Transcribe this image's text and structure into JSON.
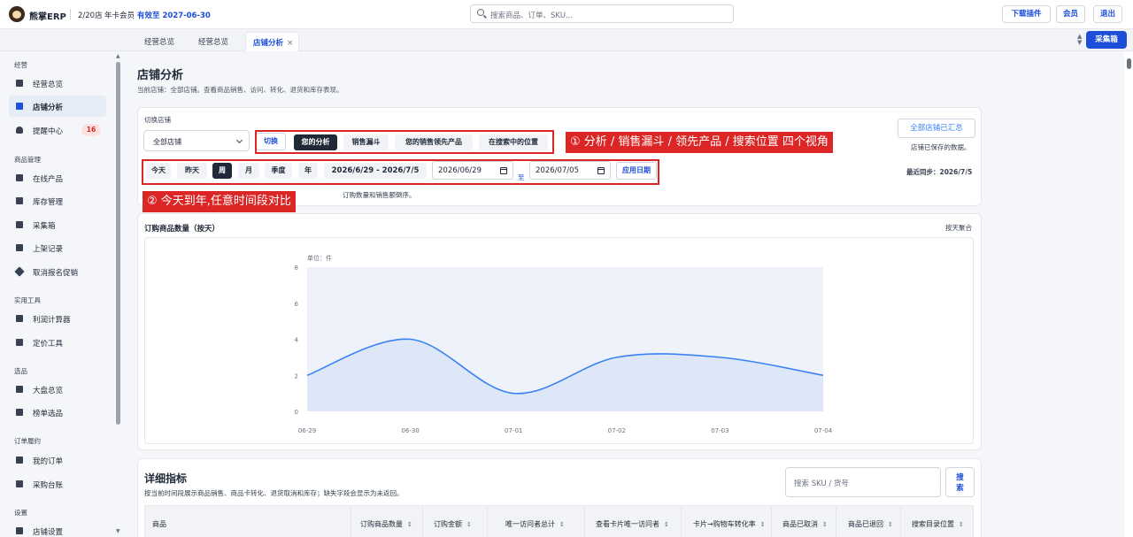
{
  "topbar": {
    "brand": "熊掌ERP",
    "stores": "2/20店",
    "member": "年卡会员",
    "valid": "有效至 2027-06-30",
    "search_placeholder": "搜索商品、订单、SKU...",
    "download_label": "下载插件",
    "member_label": "会员",
    "logout_label": "退出"
  },
  "tabs": [
    {
      "label": "经营总览"
    },
    {
      "label": "经营总览"
    },
    {
      "label": "店铺分析",
      "close": "×"
    }
  ],
  "collect_label": "采集箱",
  "sidebar": {
    "sections": [
      {
        "title": "经营",
        "items": [
          {
            "label": "经营总览"
          },
          {
            "label": "店铺分析",
            "active": true
          },
          {
            "label": "提醒中心",
            "badge": "16"
          }
        ]
      },
      {
        "title": "商品管理",
        "items": [
          {
            "label": "在线产品"
          },
          {
            "label": "库存管理"
          },
          {
            "label": "采集箱"
          },
          {
            "label": "上架记录"
          },
          {
            "label": "取消报名促销"
          }
        ]
      },
      {
        "title": "实用工具",
        "items": [
          {
            "label": "利润计算器"
          },
          {
            "label": "定价工具"
          }
        ]
      },
      {
        "title": "选品",
        "items": [
          {
            "label": "大盘总览"
          },
          {
            "label": "榜单选品"
          }
        ]
      },
      {
        "title": "订单履约",
        "items": [
          {
            "label": "我的订单"
          },
          {
            "label": "采购台账"
          }
        ]
      },
      {
        "title": "设置",
        "items": [
          {
            "label": "店铺设置"
          }
        ]
      }
    ]
  },
  "page": {
    "title": "店铺分析",
    "subtitle": "当前店铺：全部店铺。查看商品销售、访问、转化、退货和库存表现。"
  },
  "filters": {
    "switch_store_label": "切换店铺",
    "store_value": "全部店铺",
    "switch_btn": "切换",
    "views": [
      "您的分析",
      "销售漏斗",
      "您的销售领先产品",
      "在搜索中的位置"
    ],
    "summary_btn": "全部店铺已汇总",
    "summary_note": "店铺已保存的数据。",
    "periods": [
      "今天",
      "昨天",
      "周",
      "月",
      "季度",
      "年"
    ],
    "active_period": "周",
    "range": "2026/6/29 - 2026/7/5",
    "start_date": "2026/06/29",
    "to": "至",
    "end_date": "2026/07/05",
    "apply": "应用日期",
    "last_sync": "最近同步：2026/7/5",
    "note": "订购数量和销售额倒序。"
  },
  "annotations": {
    "views": "① 分析 / 销售漏斗 / 领先产品 / 搜索位置 四个视角",
    "dates": "② 今天到年,任意时间段对比"
  },
  "chart_card": {
    "title": "订购商品数量（按天）",
    "aggregate": "按天聚合"
  },
  "chart_data": {
    "type": "area",
    "title": "",
    "ylabel": "单位：件",
    "x": [
      "06-29",
      "06-30",
      "07-01",
      "07-02",
      "07-03",
      "07-04"
    ],
    "series": [
      {
        "values": [
          2,
          4,
          1,
          3,
          3,
          2
        ]
      }
    ],
    "ylim": [
      0,
      8
    ],
    "yticks": [
      0,
      2,
      4,
      6,
      8
    ],
    "grid": false,
    "colors": {
      "line": "#3b82f6",
      "fill": "#dbe5f7"
    }
  },
  "details": {
    "title": "详细指标",
    "subtitle": "按当前时间段展示商品销售、商品卡转化、退货取消和库存；缺失字段会显示为未返回。",
    "search_placeholder": "搜索 SKU / 货号",
    "search_btn": "搜索",
    "columns": [
      "商品",
      "订购商品数量",
      "订购金额",
      "唯一访问者总计",
      "查看卡片唯一访问者",
      "卡片→购物车转化率",
      "商品已取消",
      "商品已退回",
      "搜索目录位置"
    ],
    "sort_glyph": "↕"
  },
  "colors": {
    "accent": "#1d4ed8",
    "annotation": "#dc2626",
    "badge": "#dc2626"
  }
}
